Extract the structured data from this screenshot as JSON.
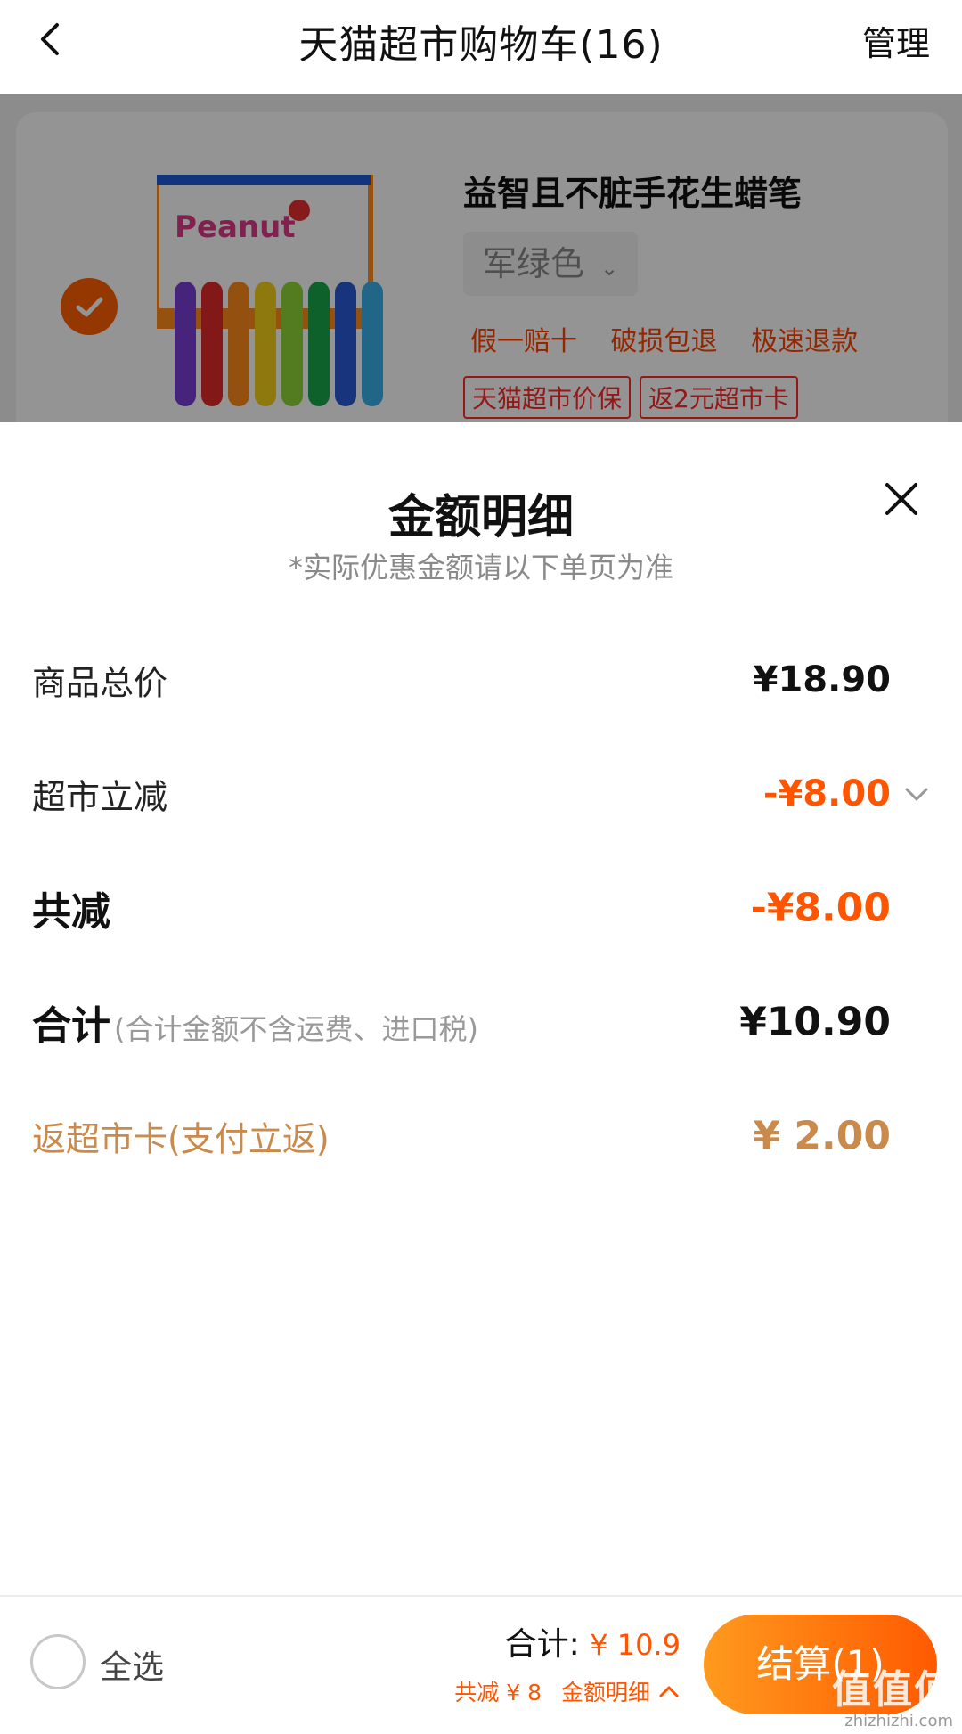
{
  "header": {
    "title": "天猫超市购物车(16)",
    "manage_label": "管理"
  },
  "cart_item": {
    "title": "益智且不脏手花生蜡笔",
    "sku": "军绿色",
    "services": [
      "假一赔十",
      "破损包退",
      "极速退款"
    ],
    "tags": [
      "天猫超市价保",
      "返2元超市卡"
    ],
    "image_brand_text": "Peanut"
  },
  "sheet": {
    "title": "金额明细",
    "subtitle": "*实际优惠金额请以下单页为准",
    "rows": {
      "goods_total": {
        "label": "商品总价",
        "value": "¥18.90"
      },
      "instant_discount": {
        "label": "超市立减",
        "value": "-¥8.00"
      },
      "total_discount": {
        "label": "共减",
        "value": "-¥8.00"
      },
      "sum": {
        "label": "合计",
        "note": "(合计金额不含运费、进口税)",
        "value": "¥10.90"
      },
      "rebate": {
        "label": "返超市卡(支付立返)",
        "value": "¥ 2.00"
      }
    }
  },
  "bottom_bar": {
    "select_all_label": "全选",
    "total_label": "合计:",
    "total_amount": "¥ 10.9",
    "discount_text": "共减 ¥ 8",
    "detail_label": "金额明细",
    "checkout_label": "结算(1)",
    "watermark": "值值值",
    "watermark_url": "zhizhizhi.com"
  },
  "colors": {
    "accent": "#ff5500",
    "gold": "#c98a4b",
    "checkout_gradient_start": "#ff9a1e",
    "checkout_gradient_end": "#ff5a00"
  }
}
